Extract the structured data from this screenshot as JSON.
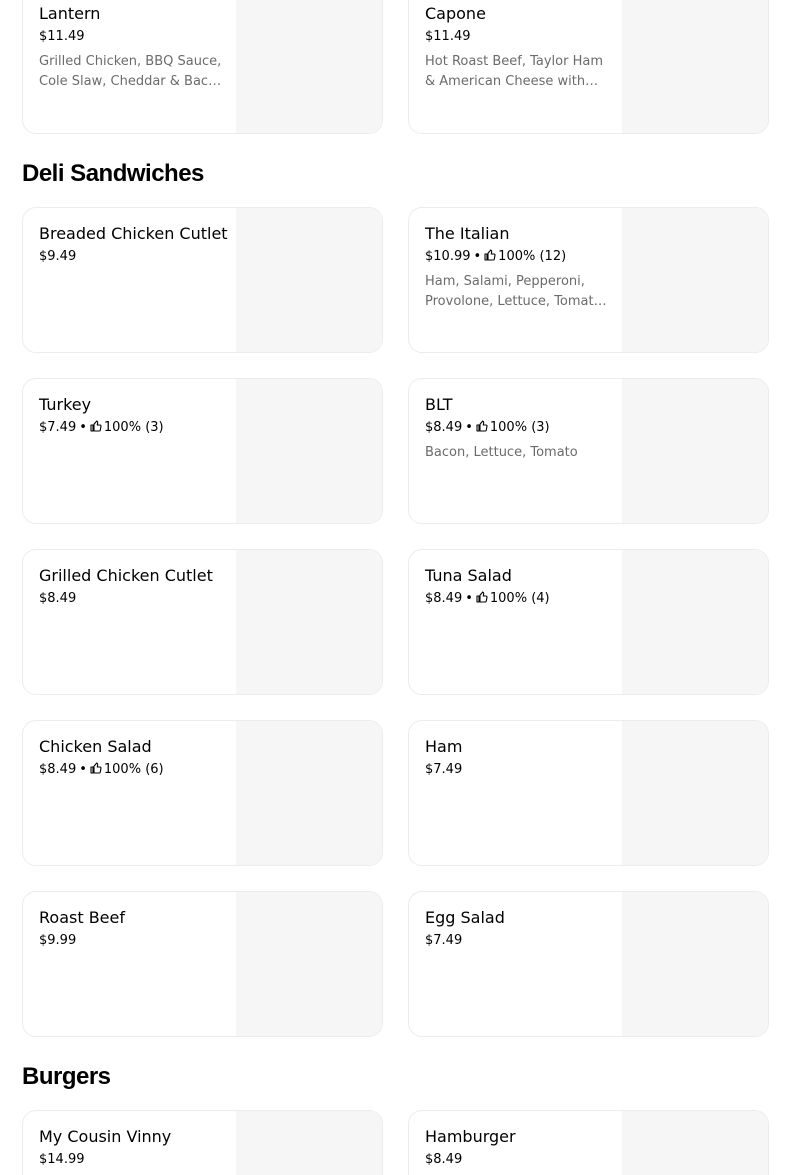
{
  "sections": {
    "deli": {
      "title": "Deli Sandwiches"
    },
    "burgers": {
      "title": "Burgers"
    }
  },
  "items": {
    "lantern": {
      "name": "Lantern",
      "price": "$11.49",
      "description": "Grilled Chicken, BBQ Sauce, Cole Slaw, Cheddar & Bacon on a Roll"
    },
    "capone": {
      "name": "Capone",
      "price": "$11.49",
      "description": "Hot Roast Beef, Taylor Ham & American Cheese with Gravy"
    },
    "breaded_chicken_cutlet": {
      "name": "Breaded Chicken Cutlet",
      "price": "$9.49"
    },
    "the_italian": {
      "name": "The Italian",
      "price": "$10.99",
      "rating": "100% (12)",
      "description": "Ham, Salami, Pepperoni, Provolone, Lettuce, Tomato, Onion, Oil & Vinegar"
    },
    "turkey": {
      "name": "Turkey",
      "price": "$7.49",
      "rating": "100% (3)"
    },
    "blt": {
      "name": "BLT",
      "price": "$8.49",
      "rating": "100% (3)",
      "description": "Bacon, Lettuce, Tomato"
    },
    "grilled_chicken_cutlet": {
      "name": "Grilled Chicken Cutlet",
      "price": "$8.49"
    },
    "tuna_salad": {
      "name": "Tuna Salad",
      "price": "$8.49",
      "rating": "100% (4)"
    },
    "chicken_salad": {
      "name": "Chicken Salad",
      "price": "$8.49",
      "rating": "100% (6)"
    },
    "ham": {
      "name": "Ham",
      "price": "$7.49"
    },
    "roast_beef": {
      "name": "Roast Beef",
      "price": "$9.99"
    },
    "egg_salad": {
      "name": "Egg Salad",
      "price": "$7.49"
    },
    "my_cousin_vinny": {
      "name": "My Cousin Vinny",
      "price": "$14.99"
    },
    "hamburger": {
      "name": "Hamburger",
      "price": "$8.49"
    }
  },
  "separator": "•",
  "icons": {
    "rating": "thumbs-up-icon"
  },
  "colors": {
    "text": "#000000",
    "muted": "#6b6b6b",
    "image_placeholder": "#f6f6f6",
    "border": "#ececec"
  }
}
